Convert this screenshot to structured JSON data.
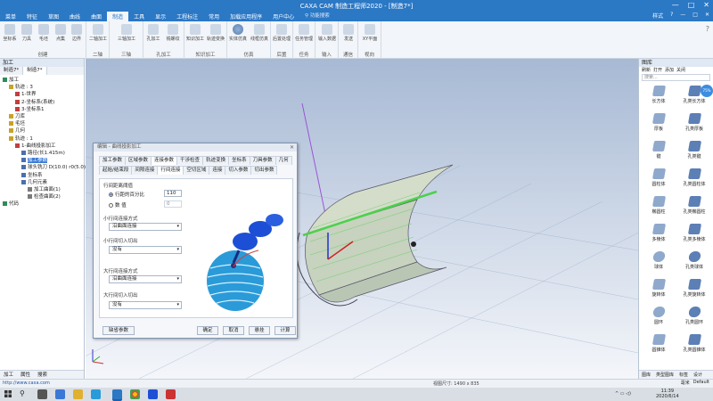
{
  "titlebar": {
    "title": "CAXA CAM 制造工程师2020 - [制造7*]",
    "controls": [
      "—",
      "□",
      "✕"
    ]
  },
  "menubar": {
    "tabs": [
      "菜单",
      "特征",
      "草图",
      "曲线",
      "曲面",
      "制造",
      "工具",
      "显示",
      "工程标注",
      "常用",
      "加载应用程序",
      "用户中心"
    ],
    "active_index": 5,
    "search_placeholder": "功能搜索",
    "right_ctrls": [
      "样式",
      "?",
      "—",
      "□",
      "✕"
    ]
  },
  "ribbon": {
    "groups": [
      {
        "name": "创建",
        "buttons": [
          "坐标系",
          "刀具",
          "毛坯",
          "点集",
          "边界"
        ]
      },
      {
        "name": "二轴",
        "buttons": [
          "二轴加工"
        ]
      },
      {
        "name": "三轴",
        "buttons": [
          "三轴加工"
        ]
      },
      {
        "name": "孔加工",
        "buttons": [
          "孔加工",
          "铣螺纹"
        ]
      },
      {
        "name": "知识加工",
        "buttons": [
          "知识加工",
          "轨迹变换"
        ]
      },
      {
        "name": "仿真",
        "buttons": [
          "实体仿真",
          "线框仿真"
        ]
      },
      {
        "name": "后置",
        "buttons": [
          "后置处理"
        ]
      },
      {
        "name": "任务",
        "buttons": [
          "任务管理"
        ]
      },
      {
        "name": "输入",
        "buttons": [
          "输入数据"
        ]
      },
      {
        "name": "通信",
        "buttons": [
          "发送"
        ]
      },
      {
        "name": "视向",
        "buttons": [
          "XY平面"
        ]
      }
    ]
  },
  "left_panel": {
    "title": "加工",
    "doc_tabs": [
      "制造7*",
      "制造7*"
    ],
    "tree": [
      {
        "label": "加工",
        "level": 0
      },
      {
        "label": "轨迹 : 3",
        "level": 1
      },
      {
        "label": "1-世界",
        "level": 2
      },
      {
        "label": "2-坐标系(系统)",
        "level": 2
      },
      {
        "label": "3-坐标系1",
        "level": 2
      },
      {
        "label": "刀库",
        "level": 1
      },
      {
        "label": "毛坯",
        "level": 1
      },
      {
        "label": "几何",
        "level": 1
      },
      {
        "label": "轨迹 : 1",
        "level": 1
      },
      {
        "label": "1-曲线投影加工",
        "level": 2
      },
      {
        "label": "路径(长1.415m)",
        "level": 3
      },
      {
        "label": "加工参数",
        "level": 3,
        "selected": true
      },
      {
        "label": "球头铣刀 D(10.0) r0(5.0)",
        "level": 3
      },
      {
        "label": "坐标系",
        "level": 3
      },
      {
        "label": "几何元素",
        "level": 3
      },
      {
        "label": "加工曲面(1)",
        "level": 4
      },
      {
        "label": "检查曲面(2)",
        "level": 4
      },
      {
        "label": "代码",
        "level": 0
      }
    ],
    "bottom_tabs": [
      "加工",
      "属性",
      "搜索"
    ]
  },
  "right_panel": {
    "title": "图库",
    "tools": [
      "刷新",
      "打开",
      "添加",
      "关闭"
    ],
    "search_placeholder": "搜索...",
    "shapes": [
      [
        "长方体",
        "孔类长方体"
      ],
      [
        "厚板",
        "孔类厚板"
      ],
      [
        "键",
        "孔类键"
      ],
      [
        "圆柱体",
        "孔类圆柱体"
      ],
      [
        "椭圆柱",
        "孔类椭圆柱"
      ],
      [
        "多棱体",
        "孔类多棱体"
      ],
      [
        "球体",
        "孔类球体"
      ],
      [
        "旋转体",
        "孔类旋转体"
      ],
      [
        "圆环",
        "孔类圆环"
      ],
      [
        "圆锥体",
        "孔类圆锥体"
      ]
    ],
    "bottom_tabs": [
      "图库",
      "类型图库",
      "标签",
      "设计"
    ],
    "side_button": "75%"
  },
  "dialog": {
    "title": "编辑 - 曲线投影加工",
    "tabs_row1": [
      "加工参数",
      "区域参数",
      "连接参数",
      "干涉检查",
      "轨迹变换",
      "坐标系",
      "刀具参数",
      "几何"
    ],
    "tabs_row2": [
      "起始/结束段",
      "间隙连接",
      "行间连接",
      "空切区域",
      "连接",
      "切入参数",
      "切出参数"
    ],
    "active_row1": 2,
    "active_row2": 2,
    "sections": {
      "row_spacing_title": "行间距离阈值",
      "radio1_label": "行距的百分比",
      "radio1_value": "110",
      "radio2_label": "数  值",
      "radio2_value": "0",
      "small_conn_title": "小行间连接方式",
      "small_conn_value": "沿曲面连接",
      "small_inout_title": "小行间切入切出",
      "small_inout_value": "没有",
      "large_conn_title": "大行间连接方式",
      "large_conn_value": "沿曲面连接",
      "large_inout_title": "大行间切入切出",
      "large_inout_value": "没有"
    },
    "buttons": {
      "defaults": "缺省参数",
      "ok": "确定",
      "cancel": "取消",
      "hide": "悬挂",
      "calc": "计算"
    }
  },
  "statusbar": {
    "url": "http://www.caxa.com",
    "viewport_size": "视图尺寸: 1490 x 835",
    "zoom_label": "毫米",
    "default_label": "Default"
  },
  "taskbar": {
    "time": "11:39",
    "date": "2020/6/14"
  },
  "colors": {
    "accent": "#2b78c5",
    "ribbon_bg": "#f2f5f9",
    "sky_top": "#a7b9d4",
    "sky_bottom": "#f4f6fa",
    "path_green": "#4cd14c",
    "tool_blue": "#1d4fd6"
  }
}
